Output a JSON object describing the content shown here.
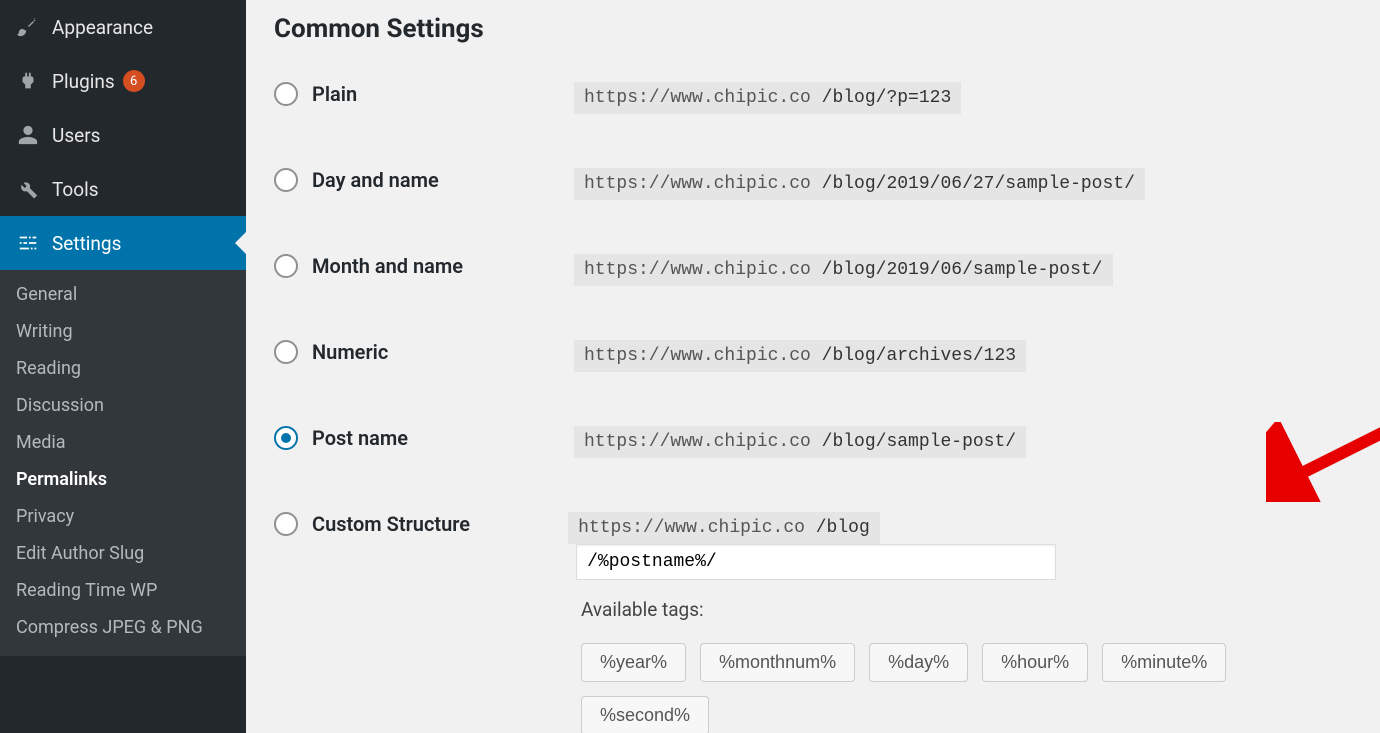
{
  "sidebar": {
    "items": [
      {
        "label": "Appearance"
      },
      {
        "label": "Plugins",
        "badge": "6"
      },
      {
        "label": "Users"
      },
      {
        "label": "Tools"
      },
      {
        "label": "Settings"
      }
    ],
    "settings_submenu": [
      "General",
      "Writing",
      "Reading",
      "Discussion",
      "Media",
      "Permalinks",
      "Privacy",
      "Edit Author Slug",
      "Reading Time WP",
      "Compress JPEG & PNG"
    ],
    "submenu_active_index": 5
  },
  "heading": "Common Settings",
  "base_url": "https://www.chipic.co",
  "options": [
    {
      "id": "plain",
      "label": "Plain",
      "suffix": "/blog/?p=123",
      "checked": false
    },
    {
      "id": "day_name",
      "label": "Day and name",
      "suffix": "/blog/2019/06/27/sample-post/",
      "checked": false
    },
    {
      "id": "month_name",
      "label": "Month and name",
      "suffix": "/blog/2019/06/sample-post/",
      "checked": false
    },
    {
      "id": "numeric",
      "label": "Numeric",
      "suffix": "/blog/archives/123",
      "checked": false
    },
    {
      "id": "post_name",
      "label": "Post name",
      "suffix": "/blog/sample-post/",
      "checked": true
    }
  ],
  "custom": {
    "label": "Custom Structure",
    "prefix": "/blog",
    "value": "/%postname%/"
  },
  "available_tags_label": "Available tags:",
  "tags": [
    "%year%",
    "%monthnum%",
    "%day%",
    "%hour%",
    "%minute%",
    "%second%"
  ]
}
